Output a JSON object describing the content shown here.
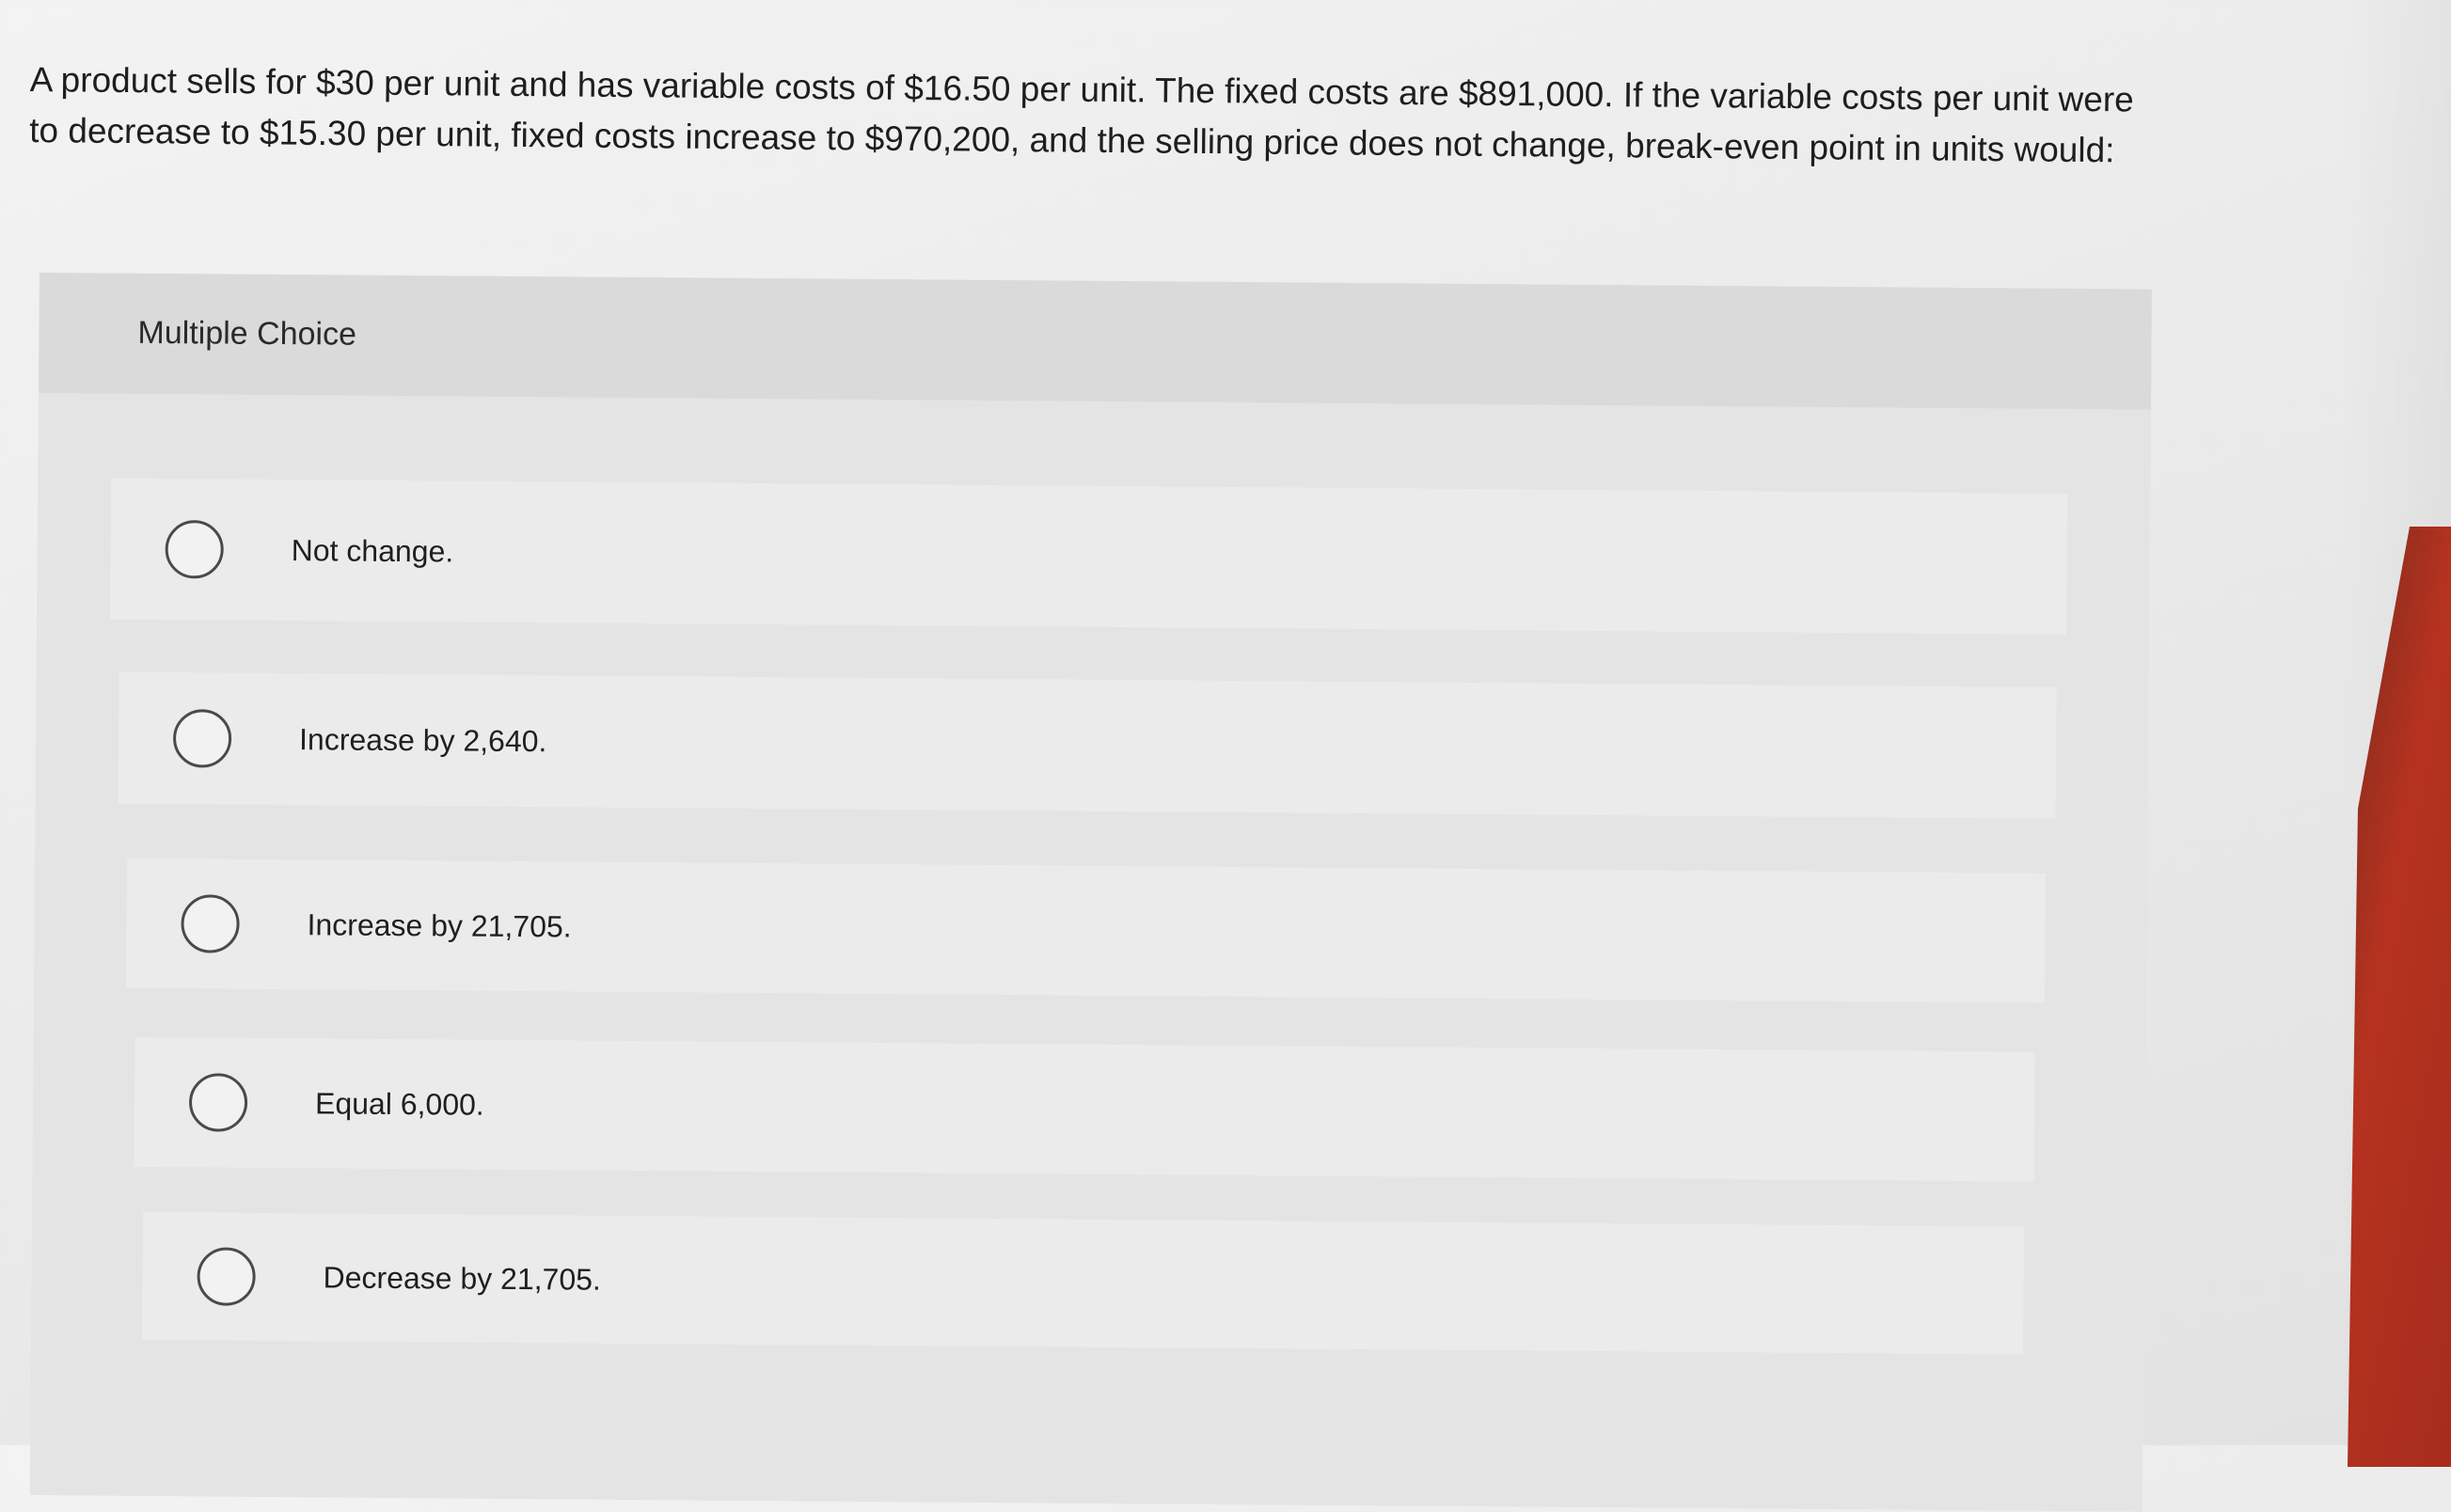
{
  "question": {
    "line1": "A product sells for $30 per unit and has variable costs of $16.50 per unit. The fixed costs are $891,000. If the variable costs per unit were",
    "line2": "to decrease to $15.30 per unit, fixed costs increase to $970,200, and the selling price does not change, break-even point in units would:"
  },
  "multiple_choice": {
    "title": "Multiple Choice",
    "options": [
      {
        "label": "Not change."
      },
      {
        "label": "Increase by 2,640."
      },
      {
        "label": "Increase by 21,705."
      },
      {
        "label": "Equal 6,000."
      },
      {
        "label": "Decrease by 21,705."
      }
    ]
  }
}
